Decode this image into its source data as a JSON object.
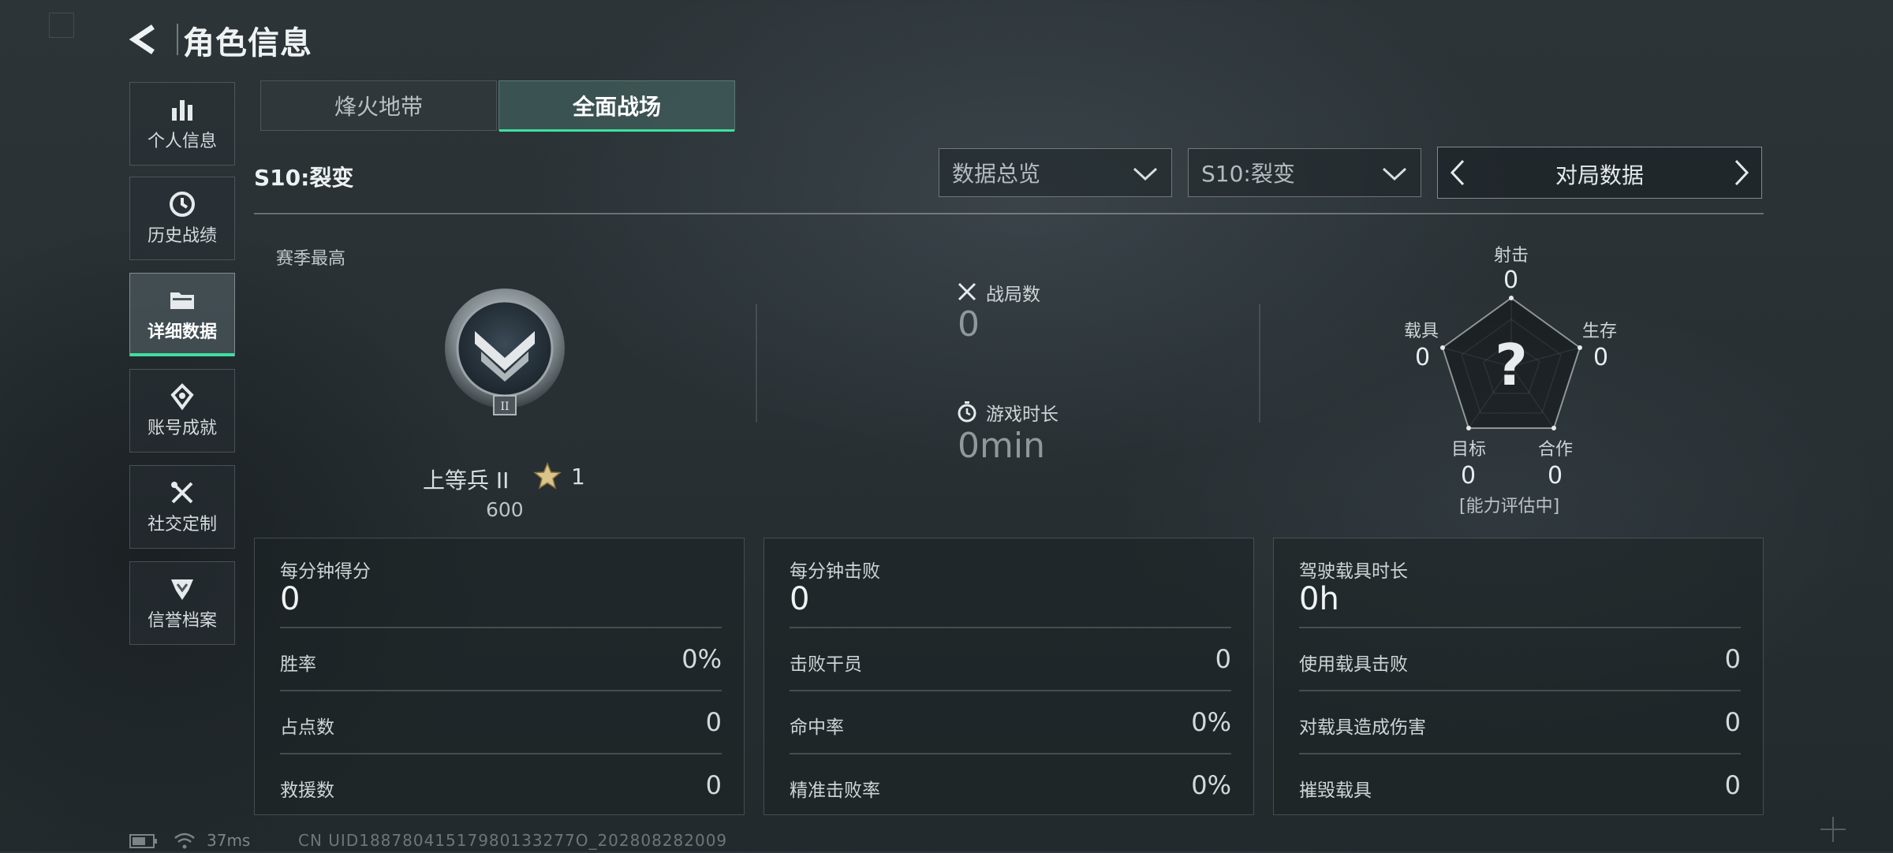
{
  "header": {
    "title": "角色信息"
  },
  "sidebar": {
    "items": [
      {
        "label": "个人信息",
        "icon": "bar-chart-icon"
      },
      {
        "label": "历史战绩",
        "icon": "clock-icon"
      },
      {
        "label": "详细数据",
        "icon": "folder-icon",
        "active": true
      },
      {
        "label": "账号成就",
        "icon": "medal-icon"
      },
      {
        "label": "社交定制",
        "icon": "tools-icon"
      },
      {
        "label": "信誉档案",
        "icon": "shield-icon"
      }
    ]
  },
  "tabs": [
    {
      "label": "烽火地带",
      "active": false
    },
    {
      "label": "全面战场",
      "active": true
    }
  ],
  "filters": {
    "season_label": "S10:裂变",
    "dropdown1": "数据总览",
    "dropdown2": "S10:裂变",
    "switcher": "对局数据"
  },
  "summary": {
    "season_best_label": "赛季最高",
    "rank_name": "上等兵 II",
    "rank_badge_numeral": "II",
    "stars": "1",
    "rank_score": "600",
    "matches_label": "战局数",
    "matches_value": "0",
    "playtime_label": "游戏时长",
    "playtime_value": "0min"
  },
  "radar": {
    "center_mark": "?",
    "axes": [
      {
        "label": "射击",
        "value": "0"
      },
      {
        "label": "生存",
        "value": "0"
      },
      {
        "label": "合作",
        "value": "0"
      },
      {
        "label": "目标",
        "value": "0"
      },
      {
        "label": "载具",
        "value": "0"
      }
    ],
    "assessment": "[能力评估中]",
    "values_normalized": [
      0,
      0,
      0,
      0,
      0
    ]
  },
  "panels": [
    {
      "title": "每分钟得分",
      "value": "0",
      "rows": [
        {
          "label": "胜率",
          "value": "0%"
        },
        {
          "label": "占点数",
          "value": "0"
        },
        {
          "label": "救援数",
          "value": "0"
        }
      ]
    },
    {
      "title": "每分钟击败",
      "value": "0",
      "rows": [
        {
          "label": "击败干员",
          "value": "0"
        },
        {
          "label": "命中率",
          "value": "0%"
        },
        {
          "label": "精准击败率",
          "value": "0%"
        }
      ]
    },
    {
      "title": "驾驶载具时长",
      "value": "0h",
      "rows": [
        {
          "label": "使用载具击败",
          "value": "0"
        },
        {
          "label": "对载具造成伤害",
          "value": "0"
        },
        {
          "label": "摧毁载具",
          "value": "0"
        }
      ]
    }
  ],
  "status": {
    "ping": "37ms",
    "uid": "CN UID18878041517980133277O_202808282009"
  },
  "colors": {
    "accent": "#3ee0a0",
    "background": "#283034"
  }
}
